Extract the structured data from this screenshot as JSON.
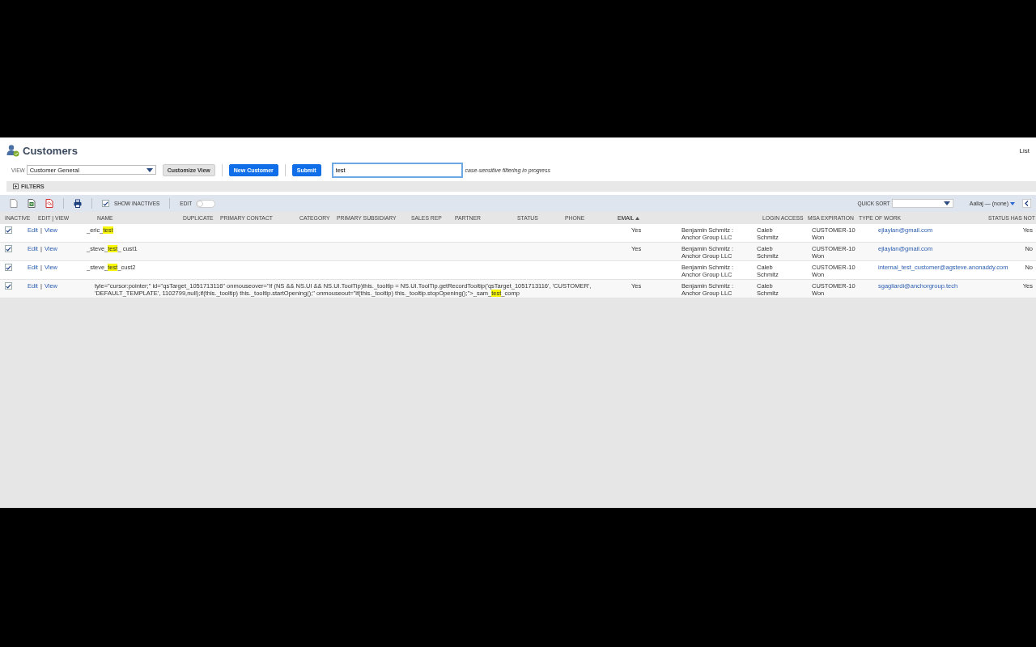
{
  "page": {
    "title": "Customers",
    "nav_link": "List"
  },
  "view": {
    "label": "VIEW",
    "value": "Customer General"
  },
  "buttons": [
    {
      "label": "Customize View",
      "kind": "secondary"
    },
    {
      "label": "New Customer",
      "kind": "primary"
    },
    {
      "label": "Submit",
      "kind": "primary"
    }
  ],
  "search": {
    "value": "test",
    "note": "case-sensitive filtering in progress"
  },
  "filters": {
    "label": "FILTERS"
  },
  "toolbar": {
    "show_inactives": {
      "label": "SHOW INACTIVES",
      "checked": true
    },
    "edit": {
      "label": "EDIT",
      "on": false
    },
    "quick_sort": {
      "label": "QUICK SORT"
    },
    "user_menu": "Aaliaj — (none)"
  },
  "table": {
    "columns": [
      {
        "label": "INACTIVE",
        "sorted": false
      },
      {
        "label": "EDIT | VIEW",
        "sorted": false
      },
      {
        "label": "NAME",
        "sorted": false
      },
      {
        "label": "DUPLICATE",
        "sorted": false
      },
      {
        "label": "PRIMARY CONTACT",
        "sorted": false
      },
      {
        "label": "CATEGORY",
        "sorted": false
      },
      {
        "label": "PRIMARY SUBSIDIARY",
        "sorted": false
      },
      {
        "label": "SALES REP",
        "sorted": false
      },
      {
        "label": "PARTNER",
        "sorted": false
      },
      {
        "label": "STATUS",
        "sorted": false
      },
      {
        "label": "PHONE",
        "sorted": false
      },
      {
        "label": "EMAIL",
        "sorted": true
      },
      {
        "label": "LOGIN ACCESS",
        "sorted": false
      },
      {
        "label": "MSA EXPIRATION",
        "sorted": false
      },
      {
        "label": "TYPE OF WORK",
        "sorted": false
      },
      {
        "label": "STATUS HAS NOT",
        "sorted": false
      }
    ],
    "rows": [
      {
        "inactive": true,
        "edit": "Edit",
        "separator": "|",
        "view": "View",
        "indented": false,
        "name": [
          {
            "text": "_eric_",
            "highlighted": false
          },
          {
            "text": "test",
            "highlighted": true
          }
        ],
        "cell_a": "Yes",
        "cell_b": "Benjamin Schmitz :\nAnchor Group LLC",
        "cell_c": "Caleb\nSchmitz",
        "cell_d": "CUSTOMER-10\nWon",
        "email": "ejlaylan@gmail.com",
        "cell_f": "Yes"
      },
      {
        "inactive": true,
        "edit": "Edit",
        "separator": "|",
        "view": "View",
        "indented": false,
        "name": [
          {
            "text": "_steve_",
            "highlighted": false
          },
          {
            "text": "test",
            "highlighted": true
          },
          {
            "text": "_ cust1",
            "highlighted": false
          }
        ],
        "cell_a": "Yes",
        "cell_b": "Benjamin Schmitz :\nAnchor Group LLC",
        "cell_c": "Caleb\nSchmitz",
        "cell_d": "CUSTOMER-10\nWon",
        "email": "ejlaylan@gmail.com",
        "cell_f": "No"
      },
      {
        "inactive": true,
        "edit": "Edit",
        "separator": "|",
        "view": "View",
        "indented": false,
        "name": [
          {
            "text": "_steve_",
            "highlighted": false
          },
          {
            "text": "test",
            "highlighted": true
          },
          {
            "text": "_cust2",
            "highlighted": false
          }
        ],
        "cell_b": "Benjamin Schmitz :\nAnchor Group LLC",
        "cell_c": "Caleb\nSchmitz",
        "cell_d": "CUSTOMER-10\nWon",
        "email": "internal_test_customer@agsteve.anonaddy.com",
        "cell_f": "No"
      },
      {
        "inactive": true,
        "edit": "Edit",
        "separator": "|",
        "view": "View",
        "indented": true,
        "name": [
          {
            "text": "tyle=\"cursor:pointer;\" id=\"qsTarget_1051713116\" onmouseover=\"if (NS && NS.UI && NS.UI.ToolTip)this._tooltip = NS.UI.ToolTip.getRecordTooltip('qsTarget_1051713116', 'CUSTOMER', 'DEFAULT_TEMPLATE', 1102799,null);if(this._tooltip) this._tooltip.startOpening();\" onmouseout=\"if(this._tooltip) this._tooltip.stopOpening();\">_sam_",
            "highlighted": false
          },
          {
            "text": "test",
            "highlighted": true
          },
          {
            "text": "_comp",
            "highlighted": false
          }
        ],
        "cell_a": "Yes",
        "cell_b": "Benjamin Schmitz :\nAnchor Group LLC",
        "cell_c": "Caleb\nSchmitz",
        "cell_d": "CUSTOMER-10\nWon",
        "email": "sgagliardi@anchorgroup.tech",
        "cell_f": "Yes"
      }
    ]
  }
}
